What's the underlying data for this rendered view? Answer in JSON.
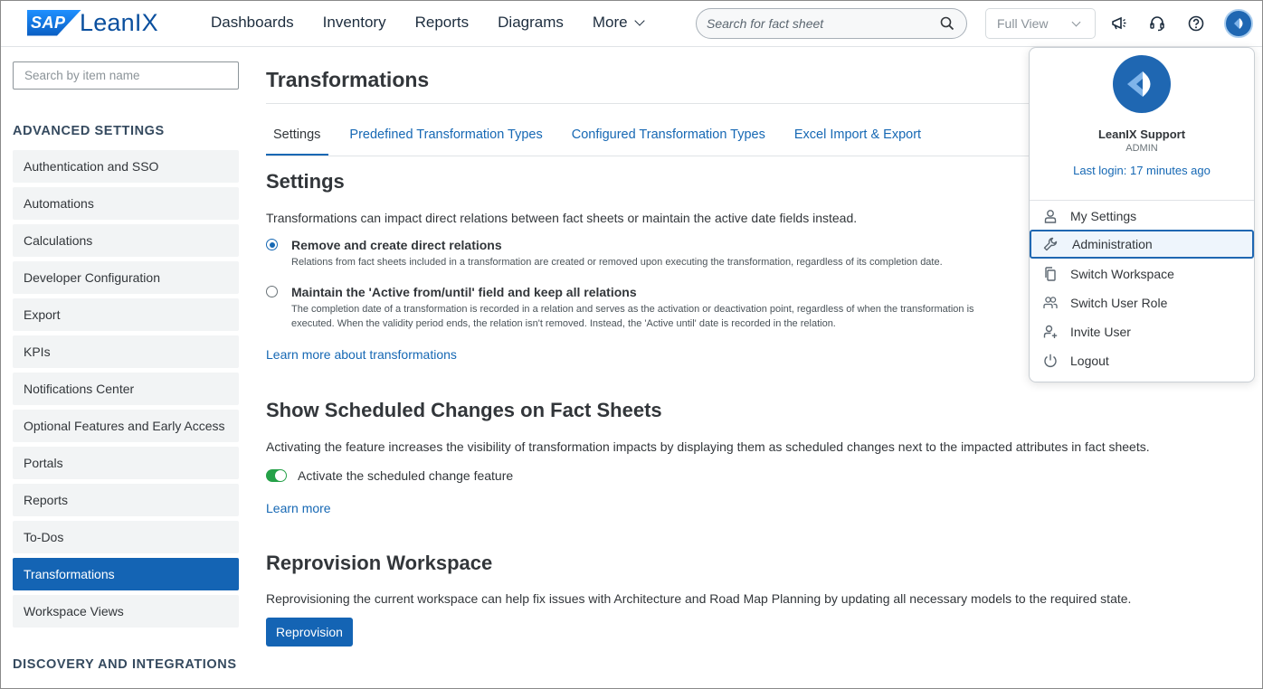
{
  "header": {
    "logo_sap": "SAP",
    "logo_brand": "LeanIX",
    "nav": [
      "Dashboards",
      "Inventory",
      "Reports",
      "Diagrams",
      "More"
    ],
    "search_placeholder": "Search for fact sheet",
    "view_select": "Full View",
    "icons": [
      "megaphone-icon",
      "headset-icon",
      "help-icon",
      "avatar"
    ]
  },
  "sidebar": {
    "search_placeholder": "Search by item name",
    "section_title": "ADVANCED SETTINGS",
    "items": [
      {
        "label": "Authentication and SSO"
      },
      {
        "label": "Automations"
      },
      {
        "label": "Calculations"
      },
      {
        "label": "Developer Configuration"
      },
      {
        "label": "Export"
      },
      {
        "label": "KPIs"
      },
      {
        "label": "Notifications Center"
      },
      {
        "label": "Optional Features and Early Access"
      },
      {
        "label": "Portals"
      },
      {
        "label": "Reports"
      },
      {
        "label": "To-Dos"
      },
      {
        "label": "Transformations",
        "active": true
      },
      {
        "label": "Workspace Views"
      }
    ],
    "section2_title": "DISCOVERY AND INTEGRATIONS"
  },
  "main": {
    "title": "Transformations",
    "tabs": [
      "Settings",
      "Predefined Transformation Types",
      "Configured Transformation Types",
      "Excel Import & Export"
    ],
    "settings": {
      "heading": "Settings",
      "intro": "Transformations can impact direct relations between fact sheets or maintain the active date fields instead.",
      "option1_title": "Remove and create direct relations",
      "option1_desc": "Relations from fact sheets included in a transformation are created or removed upon executing the transformation, regardless of its completion date.",
      "option2_title": "Maintain the 'Active from/until' field and keep all relations",
      "option2_desc": "The completion date of a transformation is recorded in a relation and serves as the activation or deactivation point, regardless of when the transformation is executed. When the validity period ends, the relation isn't removed. Instead, the 'Active until' date is recorded in the relation.",
      "learn_more": "Learn more about transformations"
    },
    "scheduled": {
      "heading": "Show Scheduled Changes on Fact Sheets",
      "intro": "Activating the feature increases the visibility of transformation impacts by displaying them as scheduled changes next to the impacted attributes in fact sheets.",
      "toggle_label": "Activate the scheduled change feature",
      "toggle_on": true,
      "learn_more": "Learn more"
    },
    "reprovision": {
      "heading": "Reprovision Workspace",
      "intro": "Reprovisioning the current workspace can help fix issues with Architecture and Road Map Planning by updating all necessary models to the required state.",
      "button": "Reprovision"
    }
  },
  "user_menu": {
    "name": "LeanIX Support",
    "role": "ADMIN",
    "last_login": "Last login: 17 minutes ago",
    "items": [
      {
        "label": "My Settings",
        "icon": "user-icon"
      },
      {
        "label": "Administration",
        "icon": "wrench-icon",
        "selected": true
      },
      {
        "label": "Switch Workspace",
        "icon": "copy-icon"
      },
      {
        "label": "Switch User Role",
        "icon": "users-icon"
      },
      {
        "label": "Invite User",
        "icon": "add-user-icon"
      },
      {
        "label": "Logout",
        "icon": "power-icon"
      }
    ]
  },
  "colors": {
    "accent": "#1668b4",
    "active_bg": "#1464b4",
    "toggle_on": "#25a148"
  }
}
